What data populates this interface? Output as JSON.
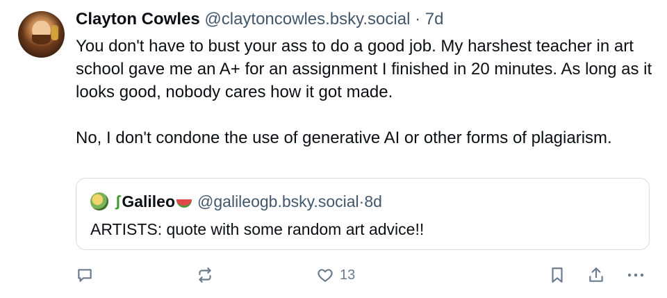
{
  "author": {
    "display_name": "Clayton Cowles",
    "handle": "@claytoncowles.bsky.social",
    "separator": "·",
    "age": "7d"
  },
  "post": {
    "paragraphs": [
      "You don't have to bust your ass to do a good job. My harshest teacher in art school gave me an A+ for an assignment I finished in 20 minutes. As long as it looks good, nobody cares how it got made.",
      "No, I don't condone the use of generative AI or other forms of plagiarism."
    ]
  },
  "quote": {
    "name_prefix_emoji": "lizard-emoji",
    "display_name": "Galileo",
    "name_suffix_emoji": "watermelon-emoji",
    "handle": "@galileogb.bsky.social",
    "separator": "·",
    "age": "8d",
    "text": "ARTISTS: quote with some random art advice!!"
  },
  "actions": {
    "reply_icon": "reply-icon",
    "repost_icon": "repost-icon",
    "like_icon": "heart-icon",
    "like_count": "13",
    "bookmark_icon": "bookmark-icon",
    "share_icon": "share-icon",
    "more_icon": "more-icon"
  },
  "colors": {
    "text": "#0b0f14",
    "muted": "#42576c",
    "icon": "#6b7b8c",
    "border": "#d4dbe2"
  }
}
